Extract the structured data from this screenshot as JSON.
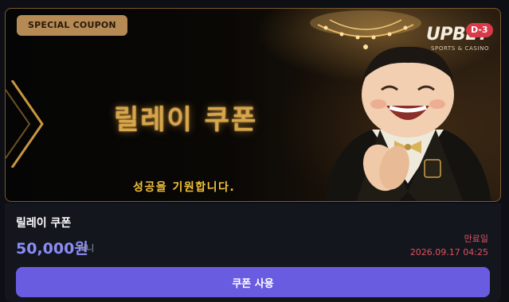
{
  "banner": {
    "badge": "SPECIAL COUPON",
    "title": "릴레이 쿠폰",
    "subtitle": "성공을 기원합니다.",
    "logo_main": "UPBET",
    "logo_sub": "SPORTS & CASINO",
    "dday": "D-3"
  },
  "coupon": {
    "name": "릴레이 쿠폰",
    "amount": "50,000원",
    "unit": "머니",
    "expiry_label": "만료일",
    "expiry_date": "2026.09.17 04:25",
    "use_button": "쿠폰 사용"
  },
  "colors": {
    "accent": "#6a5ce0",
    "amount": "#8b8cf5",
    "expiry": "#e0505e",
    "gold": "#d8a64a"
  },
  "icons": [
    "chevron-right-icon",
    "chandelier-image",
    "mascot-image",
    "upbet-logo"
  ]
}
